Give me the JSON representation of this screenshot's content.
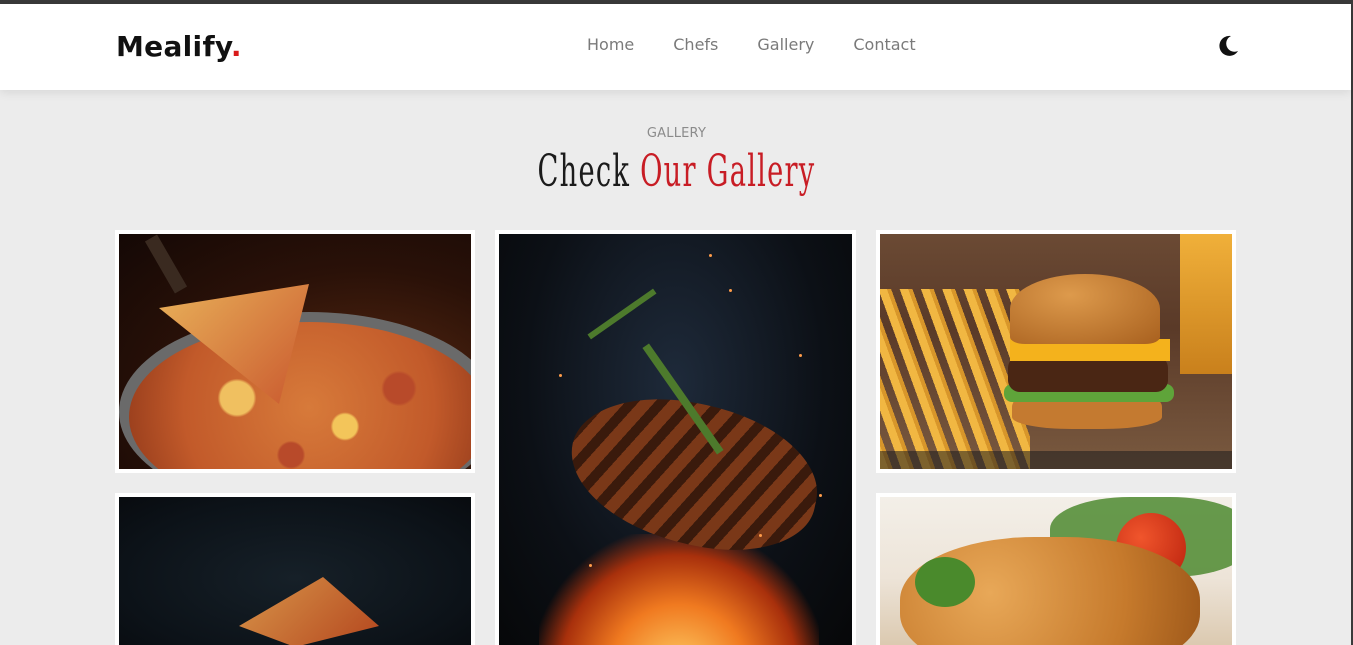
{
  "header": {
    "logo_text": "Mealify",
    "logo_dot": ".",
    "nav": [
      {
        "label": "Home"
      },
      {
        "label": "Chefs"
      },
      {
        "label": "Gallery"
      },
      {
        "label": "Contact"
      }
    ],
    "theme_icon": "moon-icon"
  },
  "gallery": {
    "eyebrow": "GALLERY",
    "title_plain": "Check",
    "title_accent": "Our Gallery",
    "images": [
      {
        "name": "pizza-photo"
      },
      {
        "name": "grilled-steak-photo"
      },
      {
        "name": "burger-fries-photo"
      },
      {
        "name": "flying-pizza-slice-photo"
      },
      {
        "name": "fried-chicken-photo"
      }
    ]
  },
  "colors": {
    "accent": "#c81d25",
    "background": "#ececec",
    "header_bg": "#ffffff",
    "nav_text": "#7a7a7a"
  }
}
